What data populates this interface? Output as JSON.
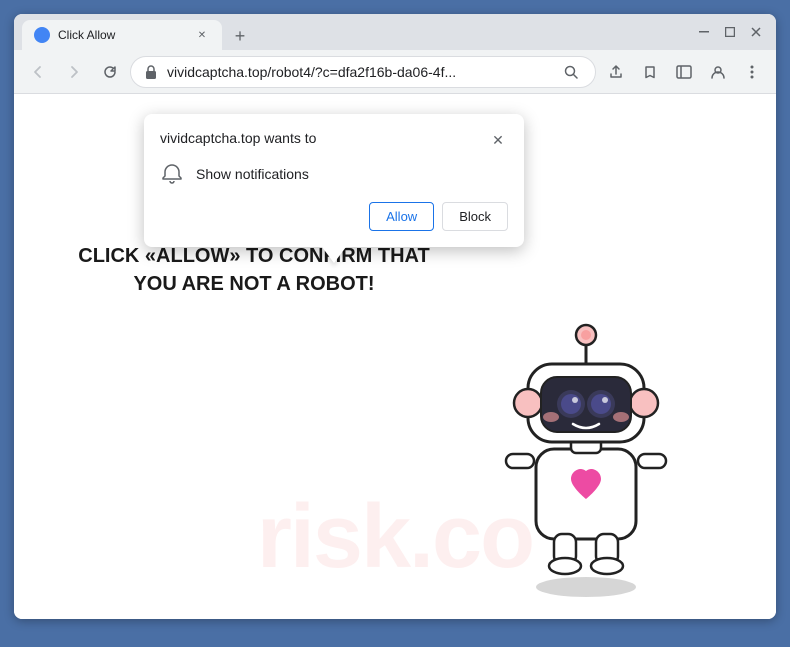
{
  "browser": {
    "tab_title": "Click Allow",
    "url": "vividcaptcha.top/robot4/?c=dfa2f16b-da06-4f...",
    "url_full": "vividcaptcha.top/robot4/?c=dfa2f16b-da06-4f...",
    "window_controls": {
      "minimize": "—",
      "maximize": "❐",
      "close": "✕"
    },
    "nav": {
      "back": "←",
      "forward": "→",
      "reload": "↻"
    }
  },
  "toolbar_icons": {
    "search": "🔍",
    "share": "↗",
    "star": "☆",
    "sidebar": "▥",
    "account": "👤",
    "menu": "⋮"
  },
  "popup": {
    "title": "vividcaptcha.top wants to",
    "notification_text": "Show notifications",
    "close_icon": "✕",
    "allow_label": "Allow",
    "block_label": "Block"
  },
  "page": {
    "main_text": "CLICK «ALLOW» TO CONFIRM THAT YOU ARE NOT A ROBOT!",
    "watermark": "risk.co"
  }
}
